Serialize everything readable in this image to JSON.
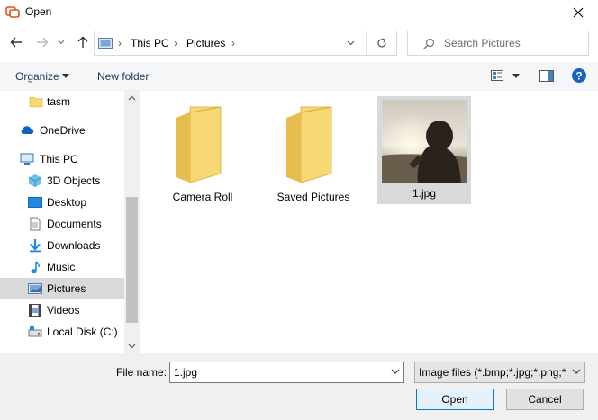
{
  "window": {
    "title": "Open"
  },
  "address": {
    "breadcrumb": [
      "This PC",
      "Pictures"
    ],
    "search_placeholder": "Search Pictures"
  },
  "toolbar": {
    "organize_label": "Organize",
    "new_folder_label": "New folder"
  },
  "sidebar": {
    "items": [
      {
        "label": "tasm",
        "icon": "folder-icon"
      },
      {
        "label": "OneDrive",
        "icon": "cloud-icon"
      },
      {
        "label": "This PC",
        "icon": "computer-icon"
      },
      {
        "label": "3D Objects",
        "icon": "cube-icon"
      },
      {
        "label": "Desktop",
        "icon": "desktop-icon"
      },
      {
        "label": "Documents",
        "icon": "document-icon"
      },
      {
        "label": "Downloads",
        "icon": "download-icon"
      },
      {
        "label": "Music",
        "icon": "music-icon"
      },
      {
        "label": "Pictures",
        "icon": "pictures-icon",
        "selected": true
      },
      {
        "label": "Videos",
        "icon": "videos-icon"
      },
      {
        "label": "Local Disk (C:)",
        "icon": "drive-icon"
      }
    ]
  },
  "files": [
    {
      "name": "Camera Roll",
      "type": "folder"
    },
    {
      "name": "Saved Pictures",
      "type": "folder"
    },
    {
      "name": "1.jpg",
      "type": "image",
      "selected": true
    }
  ],
  "bottom": {
    "file_name_label": "File name:",
    "file_name_value": "1.jpg",
    "filter_value": "Image files (*.bmp;*.jpg;*.png;*",
    "open_label": "Open",
    "cancel_label": "Cancel"
  },
  "colors": {
    "accent": "#0078d7",
    "selection": "#d9d9d9",
    "folder": "#f8d775"
  }
}
